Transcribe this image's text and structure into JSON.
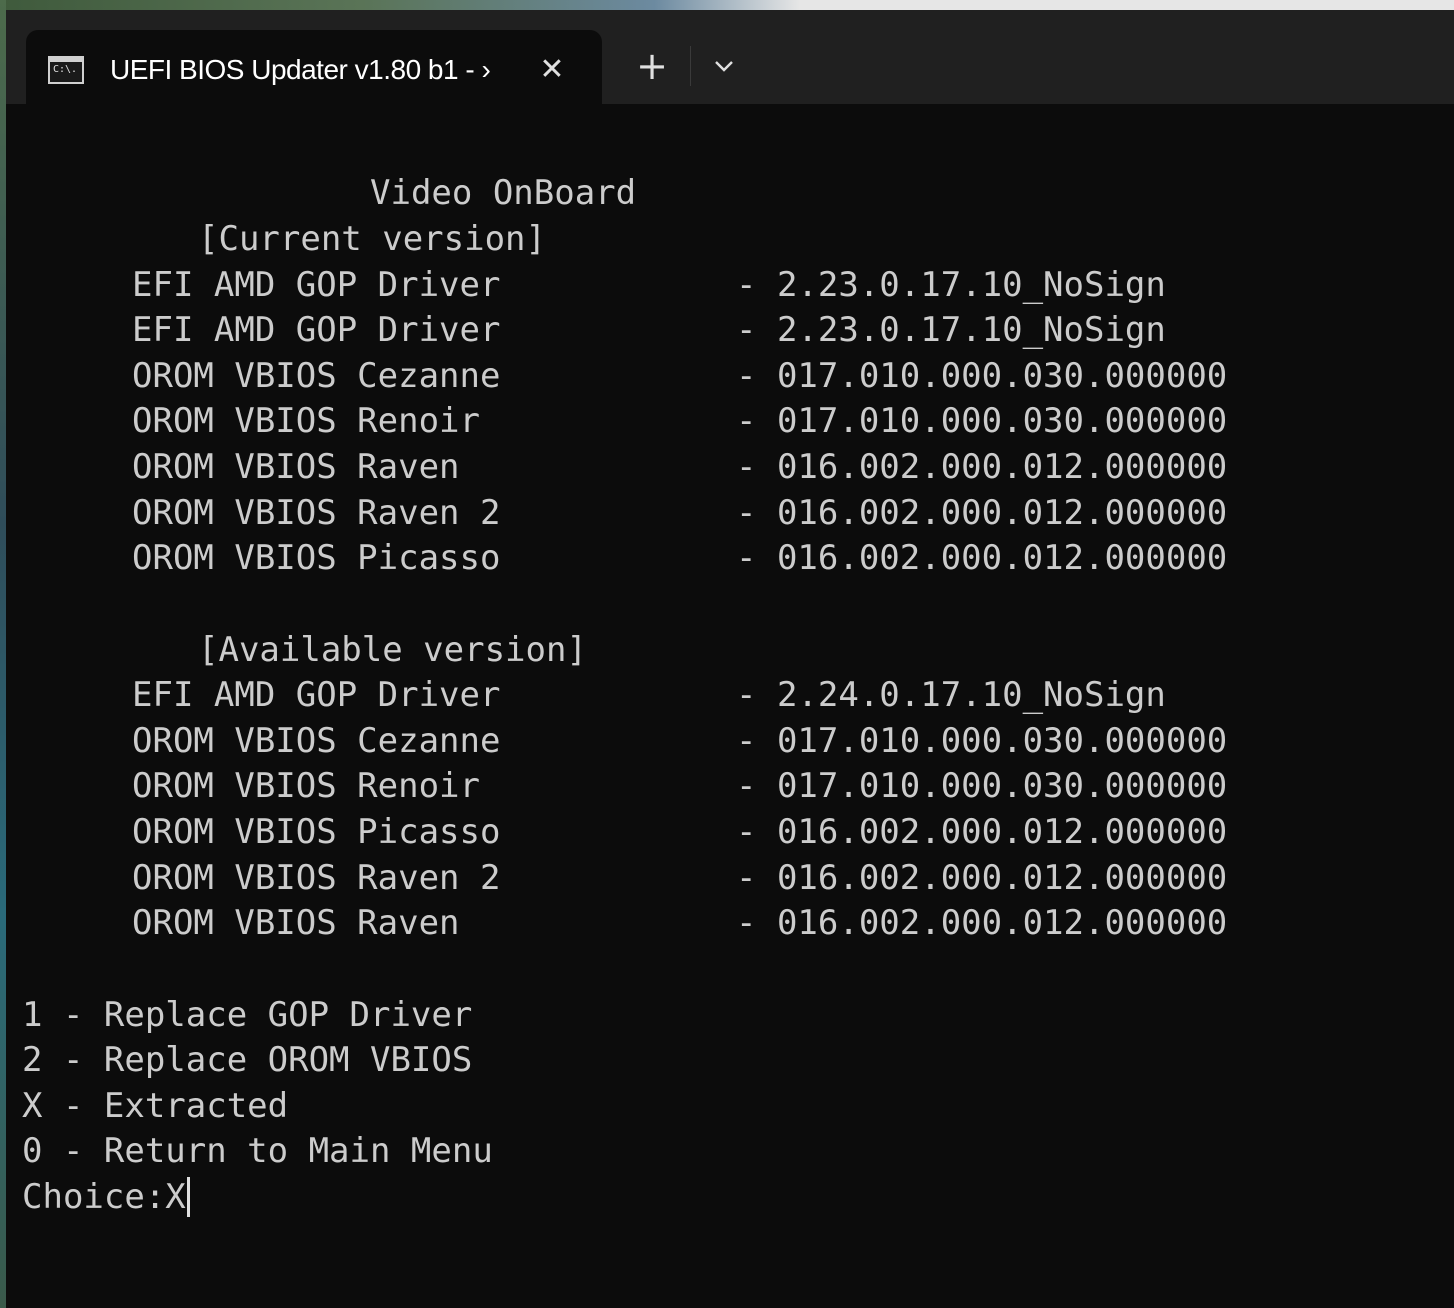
{
  "window": {
    "tab_title": "UEFI BIOS Updater v1.80 b1 - ›",
    "tab_icon_text": "C:\\.",
    "close_glyph": "✕",
    "new_tab_glyph": "+"
  },
  "terminal": {
    "heading": "Video OnBoard",
    "current_label": "[Current version]",
    "current_items": [
      {
        "name": "EFI AMD GOP Driver",
        "version": "- 2.23.0.17.10_NoSign"
      },
      {
        "name": "EFI AMD GOP Driver",
        "version": "- 2.23.0.17.10_NoSign"
      },
      {
        "name": "OROM VBIOS Cezanne",
        "version": "- 017.010.000.030.000000"
      },
      {
        "name": "OROM VBIOS Renoir",
        "version": "- 017.010.000.030.000000"
      },
      {
        "name": "OROM VBIOS Raven",
        "version": "- 016.002.000.012.000000"
      },
      {
        "name": "OROM VBIOS Raven 2",
        "version": "- 016.002.000.012.000000"
      },
      {
        "name": "OROM VBIOS Picasso",
        "version": "- 016.002.000.012.000000"
      }
    ],
    "available_label": "[Available version]",
    "available_items": [
      {
        "name": "EFI AMD GOP Driver",
        "version": "- 2.24.0.17.10_NoSign"
      },
      {
        "name": "OROM VBIOS Cezanne",
        "version": "- 017.010.000.030.000000"
      },
      {
        "name": "OROM VBIOS Renoir",
        "version": "- 017.010.000.030.000000"
      },
      {
        "name": "OROM VBIOS Picasso",
        "version": "- 016.002.000.012.000000"
      },
      {
        "name": "OROM VBIOS Raven 2",
        "version": "- 016.002.000.012.000000"
      },
      {
        "name": "OROM VBIOS Raven",
        "version": "- 016.002.000.012.000000"
      }
    ],
    "menu": [
      "1 - Replace GOP Driver",
      "2 - Replace OROM VBIOS",
      "X - Extracted",
      "0 - Return to Main Menu"
    ],
    "prompt": "Choice:",
    "input_value": "X"
  },
  "colors": {
    "terminal_bg": "#0c0c0c",
    "terminal_fg": "#cccccc",
    "tabbar_bg": "#202020"
  }
}
